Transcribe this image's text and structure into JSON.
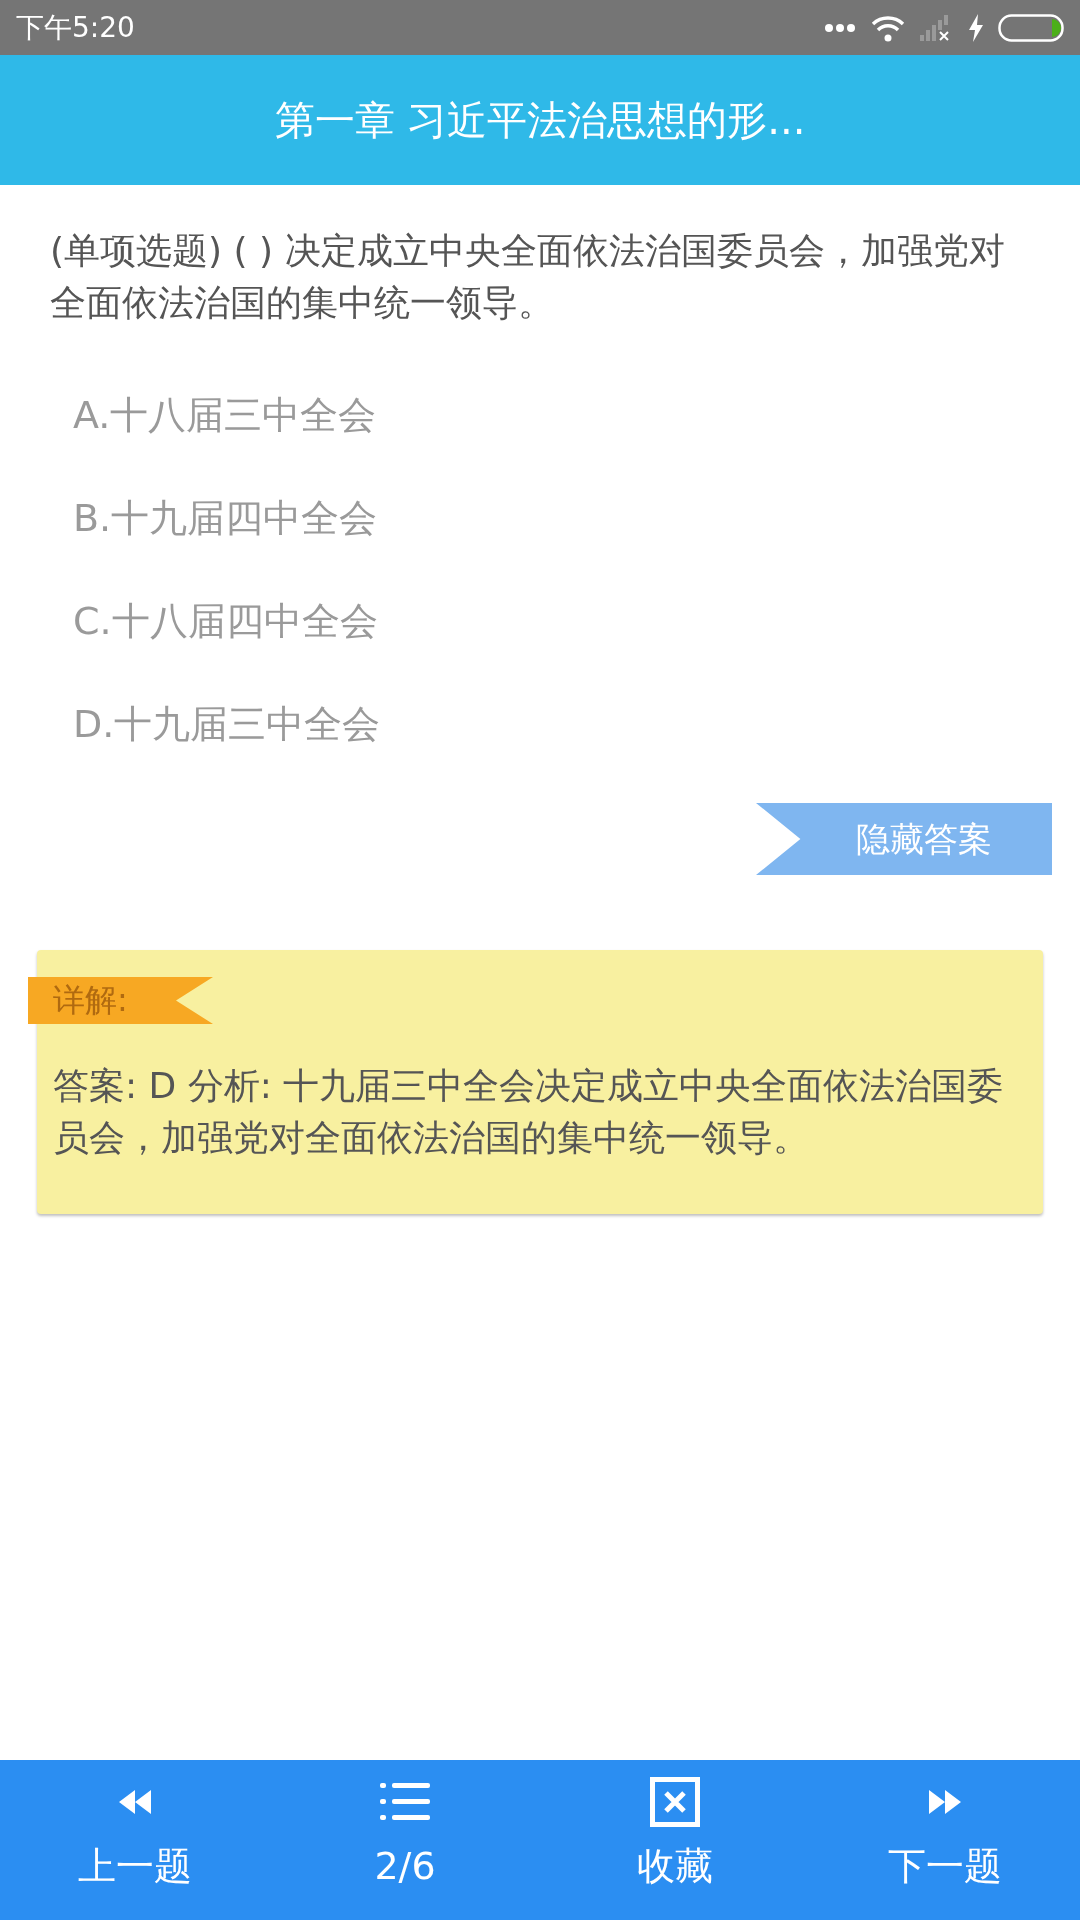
{
  "status_bar": {
    "time": "下午5:20"
  },
  "header": {
    "title": "第一章 习近平法治思想的形..."
  },
  "question": {
    "text": "(单项选题) ( ) 决定成立中央全面依法治国委员会，加强党对全面依法治国的集中统一领导。"
  },
  "options": [
    "A.十八届三中全会",
    "B.十九届四中全会",
    "C.十八届四中全会",
    "D.十九届三中全会"
  ],
  "toggle_button": {
    "label": "隐藏答案"
  },
  "explanation": {
    "tag": "详解:",
    "text": "答案: D 分析: 十九届三中全会决定成立中央全面依法治国委员会，加强党对全面依法治国的集中统一领导。"
  },
  "bottom_bar": [
    {
      "kind": "prev",
      "label": "上一题"
    },
    {
      "kind": "list",
      "label": "2/6"
    },
    {
      "kind": "favorite",
      "label": "收藏"
    },
    {
      "kind": "next",
      "label": "下一题"
    }
  ]
}
